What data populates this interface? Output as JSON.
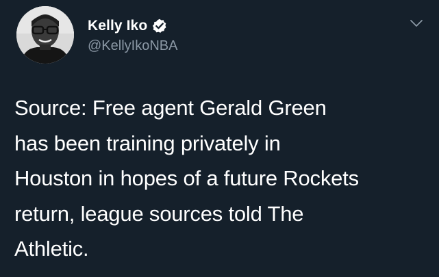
{
  "author": {
    "display_name": "Kelly Iko",
    "handle": "@KellyIkoNBA",
    "verified": true,
    "verified_icon": "verified-badge-icon",
    "avatar_icon": "profile-photo"
  },
  "menu": {
    "icon": "chevron-down-icon"
  },
  "tweet": {
    "lines": [
      "Source: Free agent Gerald Green",
      "has been training privately in",
      "Houston in hopes of a future Rockets",
      "return, league sources told The",
      "Athletic."
    ]
  },
  "colors": {
    "background": "#15202b",
    "text": "#ffffff",
    "secondary_text": "#8b98a5"
  }
}
